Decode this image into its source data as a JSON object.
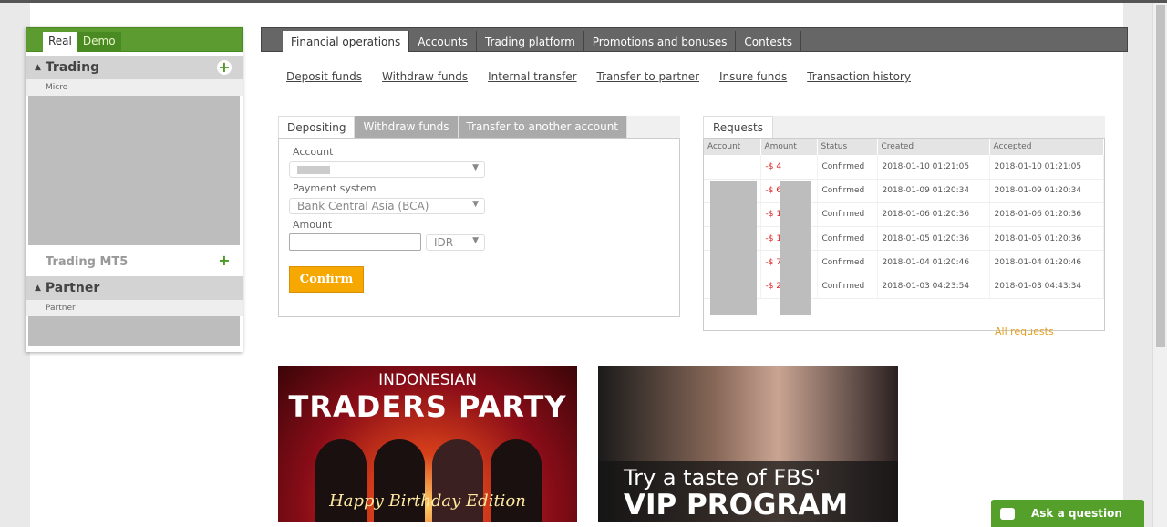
{
  "sidebar": {
    "tabs": [
      "Real",
      "Demo"
    ],
    "sections": [
      {
        "title": "Trading",
        "sub": "Micro"
      },
      {
        "title": "Trading MT5"
      },
      {
        "title": "Partner",
        "sub": "Partner"
      }
    ]
  },
  "main_tabs": [
    "Financial operations",
    "Accounts",
    "Trading platform",
    "Promotions and bonuses",
    "Contests"
  ],
  "sub_links": [
    "Deposit funds",
    "Withdraw funds",
    "Internal transfer",
    "Transfer to partner",
    "Insure funds",
    "Transaction history"
  ],
  "form": {
    "tabs": [
      "Depositing",
      "Withdraw funds",
      "Transfer to another account"
    ],
    "account_label": "Account",
    "payment_label": "Payment system",
    "payment_value": "Bank Central Asia (BCA)",
    "amount_label": "Amount",
    "amount_value": "",
    "currency": "IDR",
    "confirm": "Confirm"
  },
  "requests": {
    "tab": "Requests",
    "columns": [
      "Account",
      "Amount",
      "Status",
      "Created",
      "Accepted"
    ],
    "rows": [
      {
        "amount": "-$ 4",
        "status": "Confirmed",
        "created": "2018-01-10 01:21:05",
        "accepted": "2018-01-10 01:21:05"
      },
      {
        "amount": "-$ 6",
        "status": "Confirmed",
        "created": "2018-01-09 01:20:34",
        "accepted": "2018-01-09 01:20:34"
      },
      {
        "amount": "-$ 1",
        "status": "Confirmed",
        "created": "2018-01-06 01:20:36",
        "accepted": "2018-01-06 01:20:36"
      },
      {
        "amount": "-$ 1",
        "status": "Confirmed",
        "created": "2018-01-05 01:20:36",
        "accepted": "2018-01-05 01:20:36"
      },
      {
        "amount": "-$ 7",
        "status": "Confirmed",
        "created": "2018-01-04 01:20:46",
        "accepted": "2018-01-04 01:20:46"
      },
      {
        "amount": "-$ 2",
        "status": "Confirmed",
        "created": "2018-01-03 04:23:54",
        "accepted": "2018-01-03 04:43:34"
      }
    ],
    "all_link": "All requests"
  },
  "banners": {
    "party": {
      "line1": "INDONESIAN",
      "line2": "TRADERS PARTY",
      "line3": "Happy Birthday Edition"
    },
    "vip": {
      "line1": "Try a taste of FBS'",
      "line2": "VIP PROGRAM"
    }
  },
  "ask_button": "Ask a question",
  "colors": {
    "brand_green": "#5c9b2f",
    "confirm": "#f6a800",
    "negative": "#dd2222"
  }
}
